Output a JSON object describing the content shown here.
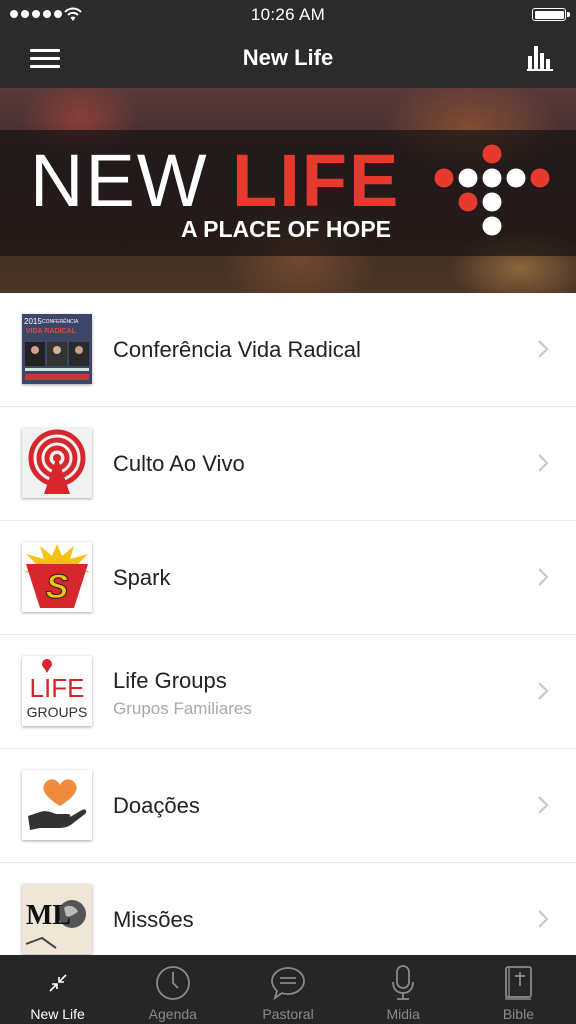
{
  "status_bar": {
    "time": "10:26 AM"
  },
  "nav": {
    "title": "New Life"
  },
  "banner": {
    "word_new": "NEW",
    "word_life": "LIFE",
    "tagline": "A PLACE OF HOPE",
    "accent_color": "#e8392f"
  },
  "list": {
    "items": [
      {
        "title": "Conferência Vida Radical",
        "subtitle": "",
        "icon": "conference-poster-thumbnail",
        "poster_year": "2015",
        "poster_heading": "CONFERÊNCIA",
        "poster_title": "VIDA RADICAL"
      },
      {
        "title": "Culto Ao Vivo",
        "subtitle": "",
        "icon": "broadcast-tower-icon"
      },
      {
        "title": "Spark",
        "subtitle": "",
        "icon": "spark-logo-icon",
        "logo_letter": "S"
      },
      {
        "title": "Life Groups",
        "subtitle": "Grupos Familiares",
        "icon": "life-groups-logo",
        "logo_line1": "LIFE",
        "logo_line2": "GROUPS"
      },
      {
        "title": "Doações",
        "subtitle": "",
        "icon": "heart-in-hand-icon"
      },
      {
        "title": "Missões",
        "subtitle": "",
        "icon": "missions-globe-icon",
        "logo_text": "ML"
      }
    ]
  },
  "tabs": [
    {
      "label": "New Life",
      "icon": "collapse-arrows-icon",
      "active": true
    },
    {
      "label": "Agenda",
      "icon": "clock-icon",
      "active": false
    },
    {
      "label": "Pastoral",
      "icon": "speech-bubble-icon",
      "active": false
    },
    {
      "label": "Midia",
      "icon": "microphone-icon",
      "active": false
    },
    {
      "label": "Bible",
      "icon": "bible-book-icon",
      "active": false
    }
  ]
}
